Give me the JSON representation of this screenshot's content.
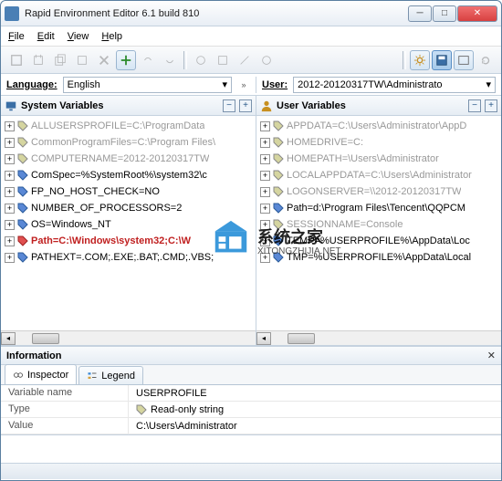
{
  "window": {
    "title": "Rapid Environment Editor 6.1 build 810"
  },
  "menu": {
    "file": "File",
    "edit": "Edit",
    "view": "View",
    "help": "Help"
  },
  "langbar": {
    "language_label": "Language:",
    "language_value": "English",
    "user_label": "User:",
    "user_value": "2012-20120317TW\\Administrato"
  },
  "panels": {
    "system": {
      "title": "System Variables",
      "rows": [
        {
          "text": "ALLUSERSPROFILE=C:\\ProgramData",
          "cls": ""
        },
        {
          "text": "CommonProgramFiles=C:\\Program Files\\",
          "cls": ""
        },
        {
          "text": "COMPUTERNAME=2012-20120317TW",
          "cls": ""
        },
        {
          "text": "ComSpec=%SystemRoot%\\system32\\c",
          "cls": "norm"
        },
        {
          "text": "FP_NO_HOST_CHECK=NO",
          "cls": "norm"
        },
        {
          "text": "NUMBER_OF_PROCESSORS=2",
          "cls": "norm"
        },
        {
          "text": "OS=Windows_NT",
          "cls": "norm"
        },
        {
          "text": "Path=C:\\Windows\\system32;C:\\W",
          "cls": "red"
        },
        {
          "text": "PATHEXT=.COM;.EXE;.BAT;.CMD;.VBS;",
          "cls": "norm"
        }
      ]
    },
    "user": {
      "title": "User Variables",
      "rows": [
        {
          "text": "APPDATA=C:\\Users\\Administrator\\AppD",
          "cls": ""
        },
        {
          "text": "HOMEDRIVE=C:",
          "cls": ""
        },
        {
          "text": "HOMEPATH=\\Users\\Administrator",
          "cls": ""
        },
        {
          "text": "LOCALAPPDATA=C:\\Users\\Administrator",
          "cls": ""
        },
        {
          "text": "LOGONSERVER=\\\\2012-20120317TW",
          "cls": ""
        },
        {
          "text": "Path=d:\\Program Files\\Tencent\\QQPCM",
          "cls": "norm"
        },
        {
          "text": "SESSIONNAME=Console",
          "cls": ""
        },
        {
          "text": "TEMP=%USERPROFILE%\\AppData\\Loc",
          "cls": "norm"
        },
        {
          "text": "TMP=%USERPROFILE%\\AppData\\Local",
          "cls": "norm"
        }
      ]
    }
  },
  "info": {
    "title": "Information",
    "tabs": {
      "inspector": "Inspector",
      "legend": "Legend"
    },
    "rows": {
      "varname_label": "Variable name",
      "varname_value": "USERPROFILE",
      "type_label": "Type",
      "type_value": "Read-only string",
      "value_label": "Value",
      "value_value": "C:\\Users\\Administrator"
    }
  },
  "watermark": {
    "title": "系统之家",
    "sub": "XITONGZHIJIA.NET"
  }
}
